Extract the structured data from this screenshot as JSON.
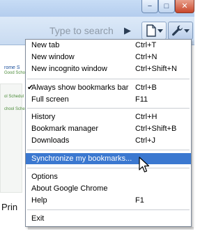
{
  "toolbar": {
    "search_placeholder": "Type to search",
    "play_icon": "▶",
    "minimize_icon": "−",
    "maximize_icon": "□",
    "close_icon": "✕"
  },
  "page_behind": {
    "strip_title1": "rome S",
    "strip_title2": "Good Scho",
    "strip_title3": "ol Schedul",
    "strip_title4": "chool Sche",
    "prin": "Prin"
  },
  "menu": {
    "items": [
      {
        "label": "New tab",
        "shortcut": "Ctrl+T"
      },
      {
        "label": "New window",
        "shortcut": "Ctrl+N"
      },
      {
        "label": "New incognito window",
        "shortcut": "Ctrl+Shift+N"
      },
      {
        "label": "Always show bookmarks bar",
        "shortcut": "Ctrl+B",
        "checked": true
      },
      {
        "label": "Full screen",
        "shortcut": "F11"
      },
      {
        "label": "History",
        "shortcut": "Ctrl+H"
      },
      {
        "label": "Bookmark manager",
        "shortcut": "Ctrl+Shift+B"
      },
      {
        "label": "Downloads",
        "shortcut": "Ctrl+J"
      },
      {
        "label": "Synchronize my bookmarks...",
        "shortcut": "",
        "highlighted": true
      },
      {
        "label": "Options",
        "shortcut": ""
      },
      {
        "label": "About Google Chrome",
        "shortcut": ""
      },
      {
        "label": "Help",
        "shortcut": "F1"
      },
      {
        "label": "Exit",
        "shortcut": ""
      }
    ],
    "check_glyph": "✔"
  },
  "colors": {
    "highlight": "#3b78d0",
    "menu_border": "#7f8a99",
    "chrome_blue": "#c9dbf1"
  }
}
